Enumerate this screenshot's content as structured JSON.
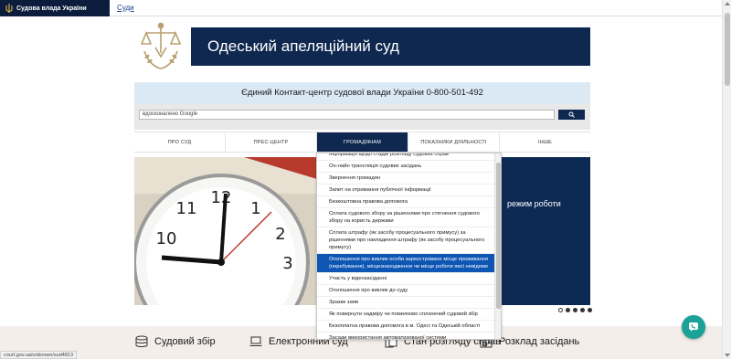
{
  "topbar": {
    "brand": "Судова влада України",
    "courts_link": "Суди"
  },
  "header": {
    "court_name": "Одеський апеляційний суд"
  },
  "contact": {
    "text": "Єдиний Контакт-центр судової влади України 0-800-501-492"
  },
  "search": {
    "placeholder": "вдосконалено Google"
  },
  "nav": [
    {
      "label": "ПРО СУД"
    },
    {
      "label": "ПРЕС-ЦЕНТР"
    },
    {
      "label": "ГРОМАДЯНАМ"
    },
    {
      "label": "ПОКАЗНИКИ ДІЯЛЬНОСТІ"
    },
    {
      "label": "ІНШЕ"
    }
  ],
  "nav_active": "ГРОМАДЯНАМ",
  "hero": {
    "text": "режим роботи"
  },
  "dropdown": {
    "items": [
      {
        "label": "Інформація щодо стадій розгляду судових справ"
      },
      {
        "label": "Он-лайн трансляція судових засідань"
      },
      {
        "label": "Звернення громадян"
      },
      {
        "label": "Запит на отримання публічної інформації"
      },
      {
        "label": "Безкоштовна правова допомога"
      },
      {
        "label": "Сплата судового збору за рішеннями про стягнення судового збору на користь держави"
      },
      {
        "label": "Сплата штрафу (як засобу процесуального примусу) за рішеннями про накладення штрафу (як засобу процесуального примусу)"
      },
      {
        "label": "Оголошення про виклик особи зареєстроване місце проживання (перебування), місцезнаходження чи місце роботи якої невідоме"
      },
      {
        "label": "Участь у відеозасіданні"
      },
      {
        "label": "Оголошення про виклик до суду"
      },
      {
        "label": "Зразки заяв"
      },
      {
        "label": "Як повернути надміру чи помилково сплачений судовий збір"
      },
      {
        "label": "Безоплатна правова допомога в м. Одесі та Одеській області"
      },
      {
        "label": "Засади використання автоматизованої системи"
      }
    ],
    "selected_index": 7
  },
  "quick_links": [
    {
      "label": "Судовий збір",
      "icon": "coins-icon"
    },
    {
      "label": "Електронний суд",
      "icon": "laptop-icon"
    },
    {
      "label": "Стан розгляду справ",
      "icon": "documents-icon"
    },
    {
      "label": "Розклад засідань",
      "icon": "calendar-icon"
    }
  ],
  "statusbar": {
    "url": "court.gov.ua/unknown/sud4813"
  },
  "colors": {
    "navy": "#0f2850",
    "brand_dark": "#0b1c3d",
    "selected_blue": "#0e56b3",
    "chat_teal": "#1aa198",
    "contact_blue": "#dbe9f5"
  },
  "slider": {
    "dots": 5,
    "active_index": 0
  }
}
